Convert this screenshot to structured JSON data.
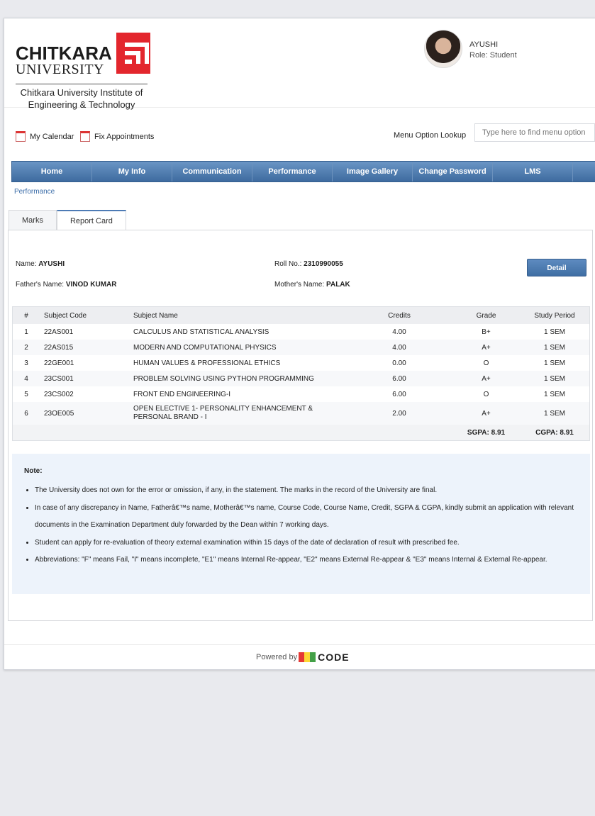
{
  "logo": {
    "name": "CHITKARA",
    "univ": "UNIVERSITY",
    "institute_line1": "Chitkara University Institute of",
    "institute_line2": "Engineering & Technology"
  },
  "user": {
    "name": "AYUSHI",
    "role": "Role: Student"
  },
  "toolbar": {
    "calendar": "My Calendar",
    "appointments": "Fix Appointments",
    "lookup_label": "Menu Option Lookup",
    "lookup_placeholder": "Type here to find menu option"
  },
  "nav": [
    "Home",
    "My Info",
    "Communication",
    "Performance",
    "Image Gallery",
    "Change Password",
    "LMS"
  ],
  "breadcrumb": "Performance",
  "tabs": [
    "Marks",
    "Report Card"
  ],
  "student": {
    "name_label": "Name:",
    "name": "AYUSHI",
    "roll_label": "Roll No.:",
    "roll": "2310990055",
    "father_label": "Father's Name:",
    "father": "VINOD KUMAR",
    "mother_label": "Mother's Name:",
    "mother": "PALAK",
    "detail_button": "Detail"
  },
  "table": {
    "headers": [
      "#",
      "Subject Code",
      "Subject Name",
      "Credits",
      "Grade",
      "Study Period"
    ],
    "rows": [
      {
        "n": "1",
        "code": "22AS001",
        "name": "CALCULUS AND STATISTICAL ANALYSIS",
        "credits": "4.00",
        "grade": "B+",
        "period": "1 SEM"
      },
      {
        "n": "2",
        "code": "22AS015",
        "name": "MODERN AND COMPUTATIONAL PHYSICS",
        "credits": "4.00",
        "grade": "A+",
        "period": "1 SEM"
      },
      {
        "n": "3",
        "code": "22GE001",
        "name": "HUMAN VALUES & PROFESSIONAL ETHICS",
        "credits": "0.00",
        "grade": "O",
        "period": "1 SEM"
      },
      {
        "n": "4",
        "code": "23CS001",
        "name": "PROBLEM SOLVING USING PYTHON PROGRAMMING",
        "credits": "6.00",
        "grade": "A+",
        "period": "1 SEM"
      },
      {
        "n": "5",
        "code": "23CS002",
        "name": "FRONT END ENGINEERING-I",
        "credits": "6.00",
        "grade": "O",
        "period": "1 SEM"
      },
      {
        "n": "6",
        "code": "23OE005",
        "name": "OPEN ELECTIVE 1- PERSONALITY ENHANCEMENT & PERSONAL BRAND - I",
        "credits": "2.00",
        "grade": "A+",
        "period": "1 SEM"
      }
    ],
    "sgpa": "SGPA: 8.91",
    "cgpa": "CGPA: 8.91"
  },
  "note": {
    "title": "Note:",
    "items": [
      "The University does not own for the error or omission, if any, in the statement. The marks in the record of the University are final.",
      "In case of any discrepancy in Name, Fatherâ€™s name, Motherâ€™s name, Course Code, Course Name, Credit, SGPA & CGPA, kindly submit an application with relevant documents in the Examination Department duly forwarded by the Dean within 7 working days.",
      "Student can apply for re-evaluation of theory external examination within 15 days of the date of declaration of result with prescribed fee.",
      "Abbreviations: \"F\" means Fail, \"I\" means incomplete, \"E1\" means Internal Re-appear, \"E2\" means External Re-appear & \"E3\" means Internal & External Re-appear."
    ]
  },
  "footer": {
    "powered": "Powered by",
    "brand": "CODE"
  },
  "colors": {
    "nav": "#4a78ad",
    "brand_red": "#e3262d",
    "note_bg": "#edf3fb"
  }
}
